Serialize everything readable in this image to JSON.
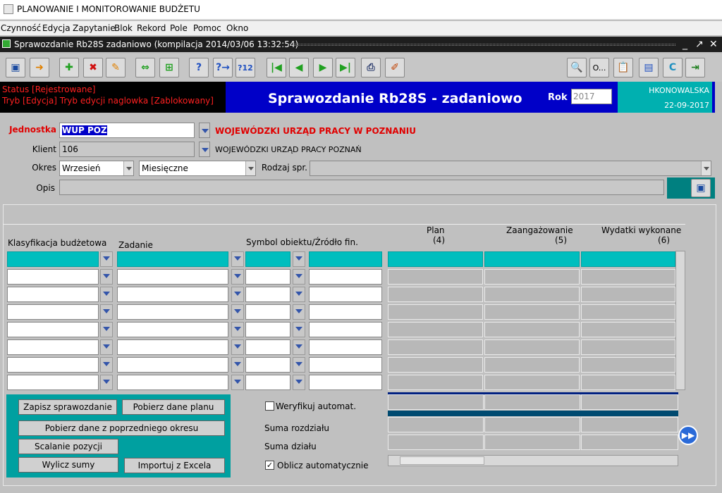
{
  "app": {
    "title": "PLANOWANIE I MONITOROWANIE BUDŻETU"
  },
  "menu": [
    "Czynność",
    "Edycja",
    "Zapytanie",
    "Blok",
    "Rekord",
    "Pole",
    "Pomoc",
    "Okno"
  ],
  "window": {
    "title": "Sprawozdanie   Rb28S   zadaniowo (kompilacja 2014/03/06 13:32:54)"
  },
  "banner": {
    "status1": "Status [Rejestrowane]",
    "status2": "Tryb [Edycja] Tryb edycji naglowka [Zablokowany]",
    "title": "Sprawozdanie Rb28S - zadaniowo",
    "rok_label": "Rok",
    "rok_value": "2017",
    "user": "HKONOWALSKA",
    "date": "22-09-2017"
  },
  "form": {
    "jednostka_label": "Jednostka",
    "jednostka_value": "WUP POZ",
    "jednostka_name": "WOJEWÓDZKI URZĄD PRACY W POZNANIU",
    "klient_label": "Klient",
    "klient_value": "106",
    "klient_name": "WOJEWÓDZKI URZĄD PRACY POZNAŃ",
    "okres_label": "Okres",
    "okres_month": "Wrzesień",
    "okres_type": "Miesięczne",
    "rodzaj_label": "Rodzaj spr.",
    "opis_label": "Opis"
  },
  "grid": {
    "col_klasyfikacja": "Klasyfikacja budżetowa",
    "col_zadanie": "Zadanie",
    "col_symbol": "Symbol obiektu/Źródło fin.",
    "col_plan": "Plan",
    "col_plan_n": "(4)",
    "col_zaang": "Zaangażowanie",
    "col_zaang_n": "(5)",
    "col_wyd": "Wydatki wykonane",
    "col_wyd_n": "(6)"
  },
  "buttons": {
    "zapisz": "Zapisz sprawozdanie",
    "pobierz_plan": "Pobierz dane planu",
    "pobierz_poprz": "Pobierz dane z poprzedniego okresu",
    "scalanie": "Scalanie pozycji",
    "wylicz": "Wylicz sumy",
    "importuj": "Importuj z Excela"
  },
  "footer": {
    "weryfikuj": "Weryfikuj automat.",
    "suma_rozdzialu": "Suma rozdziału",
    "suma_dzialu": "Suma działu",
    "oblicz": "Oblicz automatycznie"
  },
  "colors": {
    "teal": "#00bebe",
    "banner": "#0000c8",
    "status_red": "#ff2020"
  }
}
